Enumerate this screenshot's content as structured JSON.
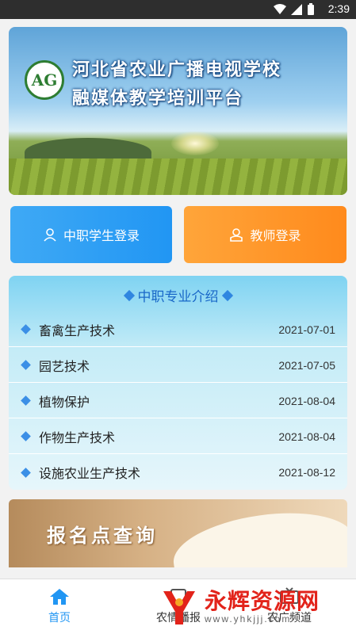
{
  "status_bar": {
    "time": "2:39"
  },
  "banner": {
    "logo_text": "AG",
    "title_line1": "河北省农业广播电视学校",
    "title_line2": "融媒体教学培训平台"
  },
  "login": {
    "student_label": "中职学生登录",
    "teacher_label": "教师登录"
  },
  "majors": {
    "title": "中职专业介绍",
    "items": [
      {
        "name": "畜禽生产技术",
        "date": "2021-07-01"
      },
      {
        "name": "园艺技术",
        "date": "2021-07-05"
      },
      {
        "name": "植物保护",
        "date": "2021-08-04"
      },
      {
        "name": "作物生产技术",
        "date": "2021-08-04"
      },
      {
        "name": "设施农业生产技术",
        "date": "2021-08-12"
      }
    ]
  },
  "query_banner": {
    "text": "报名点查询"
  },
  "tabbar": {
    "home": "首页",
    "news": "农情播报",
    "mine": "农广频道"
  },
  "watermark": {
    "text": "永辉资源网",
    "url": "www.yhkjjj.com"
  },
  "colors": {
    "accent": "#2196f3",
    "student_button": "#2196f3",
    "teacher_button": "#ff8a1c",
    "watermark": "#e2231a"
  }
}
